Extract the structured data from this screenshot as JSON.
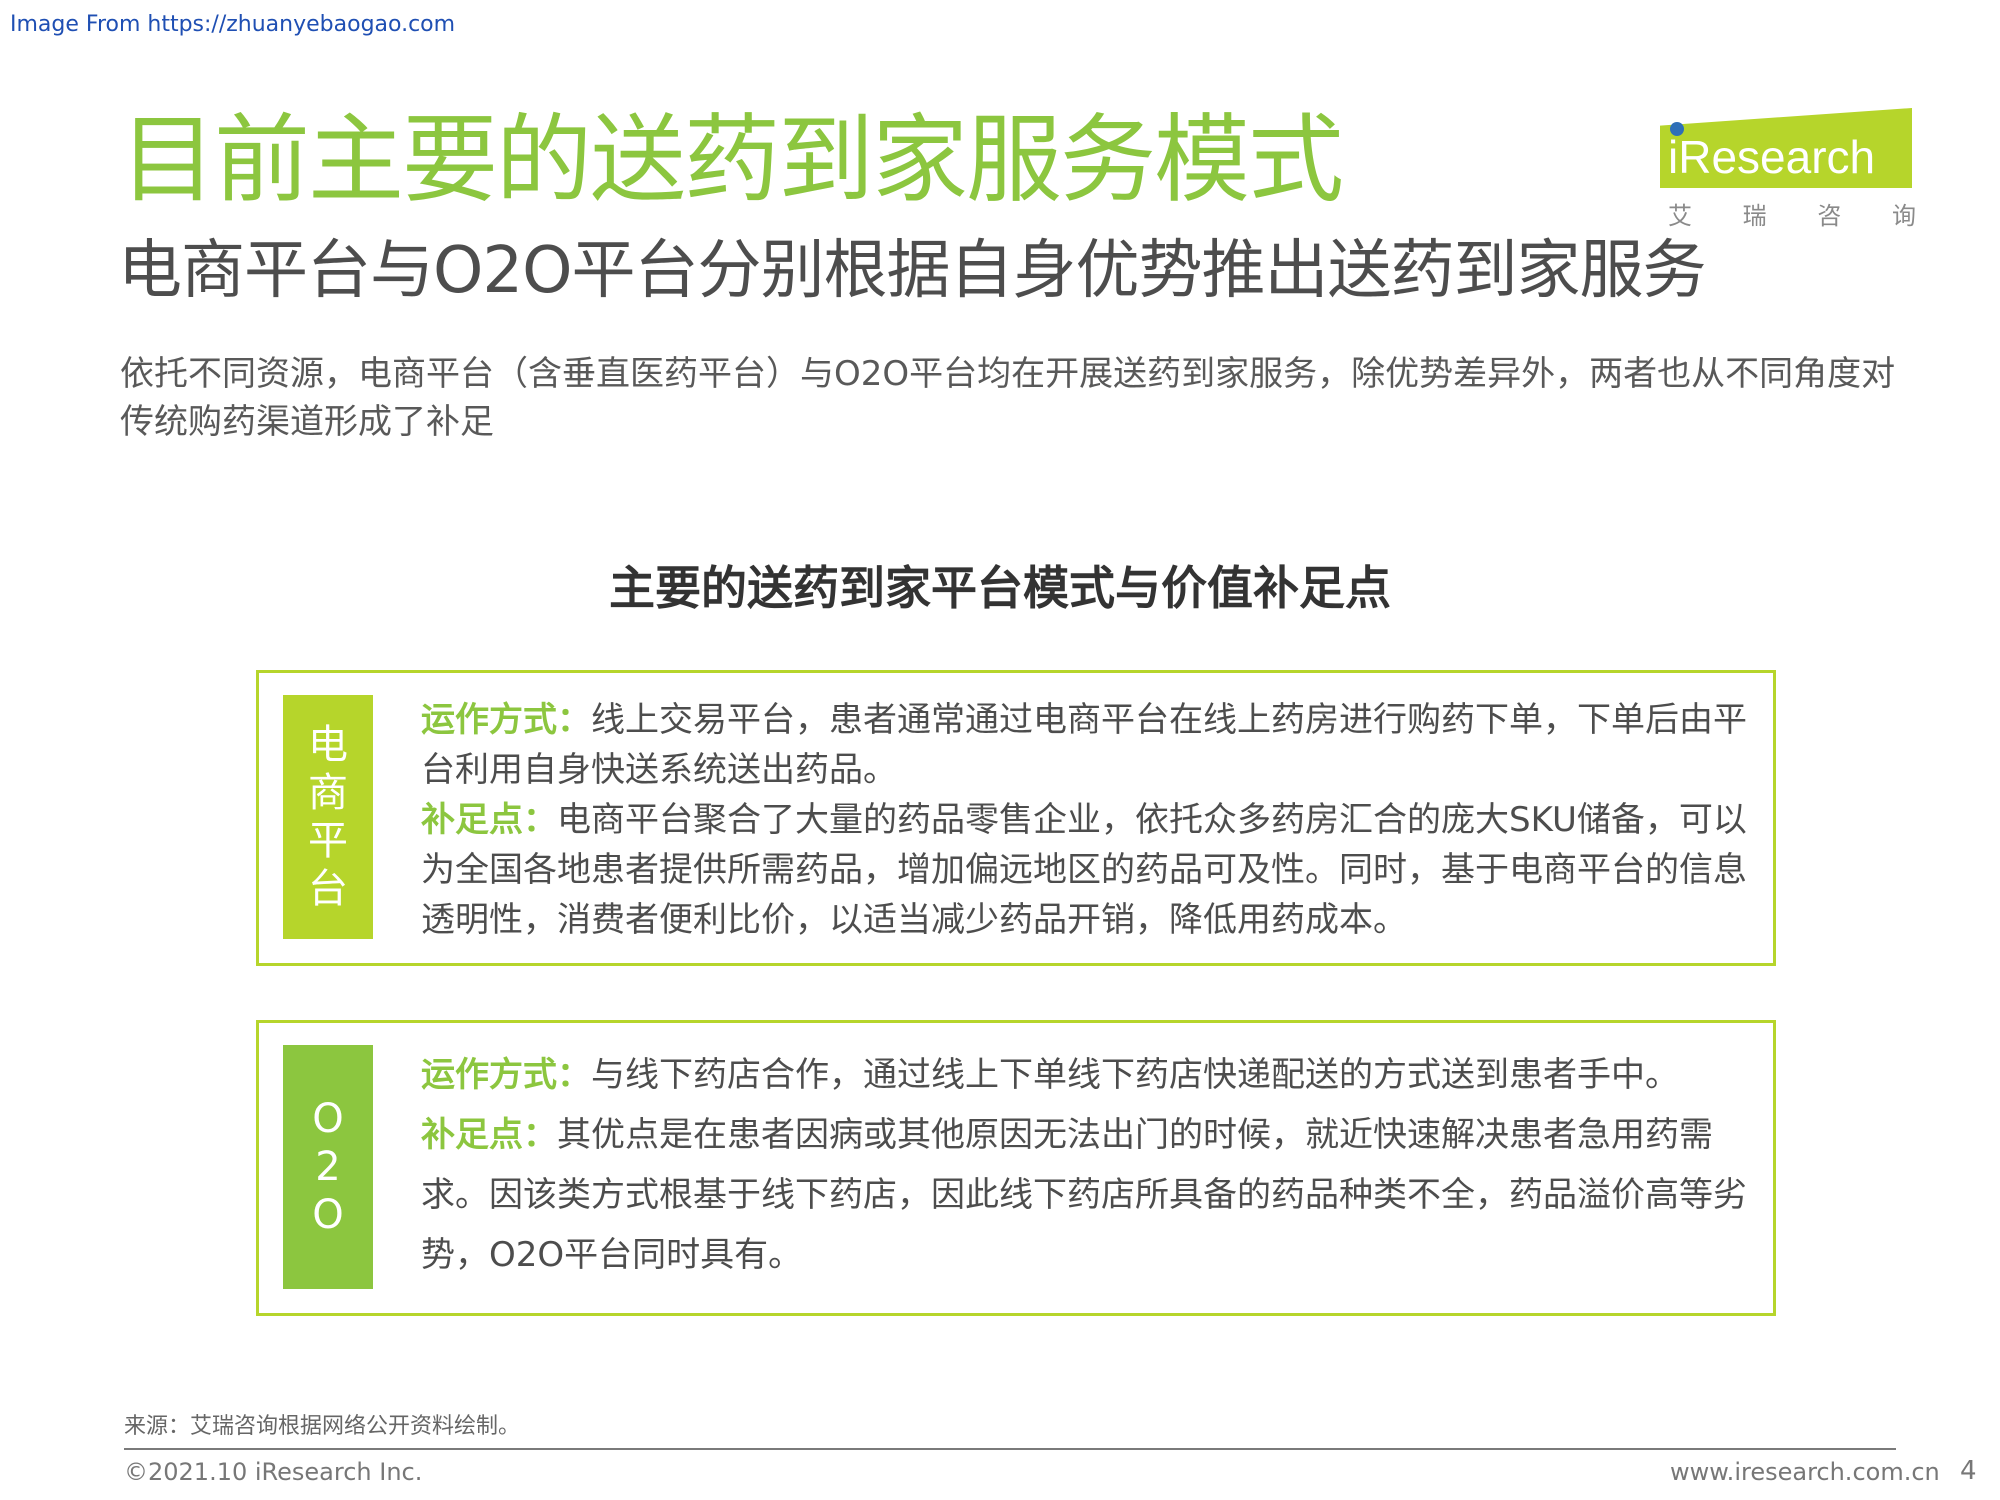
{
  "watermark": "Image From https://zhuanyebaogao.com",
  "header": {
    "title": "目前主要的送药到家服务模式",
    "subtitle": "电商平台与O2O平台分别根据自身优势推出送药到家服务",
    "intro": "依托不同资源，电商平台（含垂直医药平台）与O2O平台均在开展送药到家服务，除优势差异外，两者也从不同角度对传统购药渠道形成了补足"
  },
  "logo": {
    "brand": "iResearch",
    "sub_chars": [
      "艾",
      "瑞",
      "咨",
      "询"
    ],
    "colors": {
      "band": "#b6d52b",
      "dot": "#2e6fb7"
    }
  },
  "section_title": "主要的送药到家平台模式与价值补足点",
  "cards": [
    {
      "tag_chars": [
        "电",
        "商",
        "平",
        "台"
      ],
      "op_label": "运作方式：",
      "op_text": "线上交易平台，患者通常通过电商平台在线上药房进行购药下单，下单后由平台利用自身快送系统送出药品。",
      "supp_label": "补足点：",
      "supp_text": "电商平台聚合了大量的药品零售企业，依托众多药房汇合的庞大SKU储备，可以为全国各地患者提供所需药品，增加偏远地区的药品可及性。同时，基于电商平台的信息透明性，消费者便利比价，以适当减少药品开销，降低用药成本。"
    },
    {
      "tag_chars": [
        "O",
        "2",
        "O"
      ],
      "op_label": "运作方式：",
      "op_text": "与线下药店合作，通过线上下单线下药店快递配送的方式送到患者手中。",
      "supp_label": "补足点：",
      "supp_text": "其优点是在患者因病或其他原因无法出门的时候，就近快速解决患者急用药需求。因该类方式根基于线下药店，因此线下药店所具备的药品种类不全，药品溢价高等劣势，O2O平台同时具有。"
    }
  ],
  "footer": {
    "source": "来源：艾瑞咨询根据网络公开资料绘制。",
    "copyright": "©2021.10 iResearch Inc.",
    "website": "www.iresearch.com.cn",
    "page_number": "4"
  },
  "colors": {
    "title_green": "#8cc63f",
    "border_lime": "#b6d52b",
    "text_gray": "#4d4d4d"
  }
}
